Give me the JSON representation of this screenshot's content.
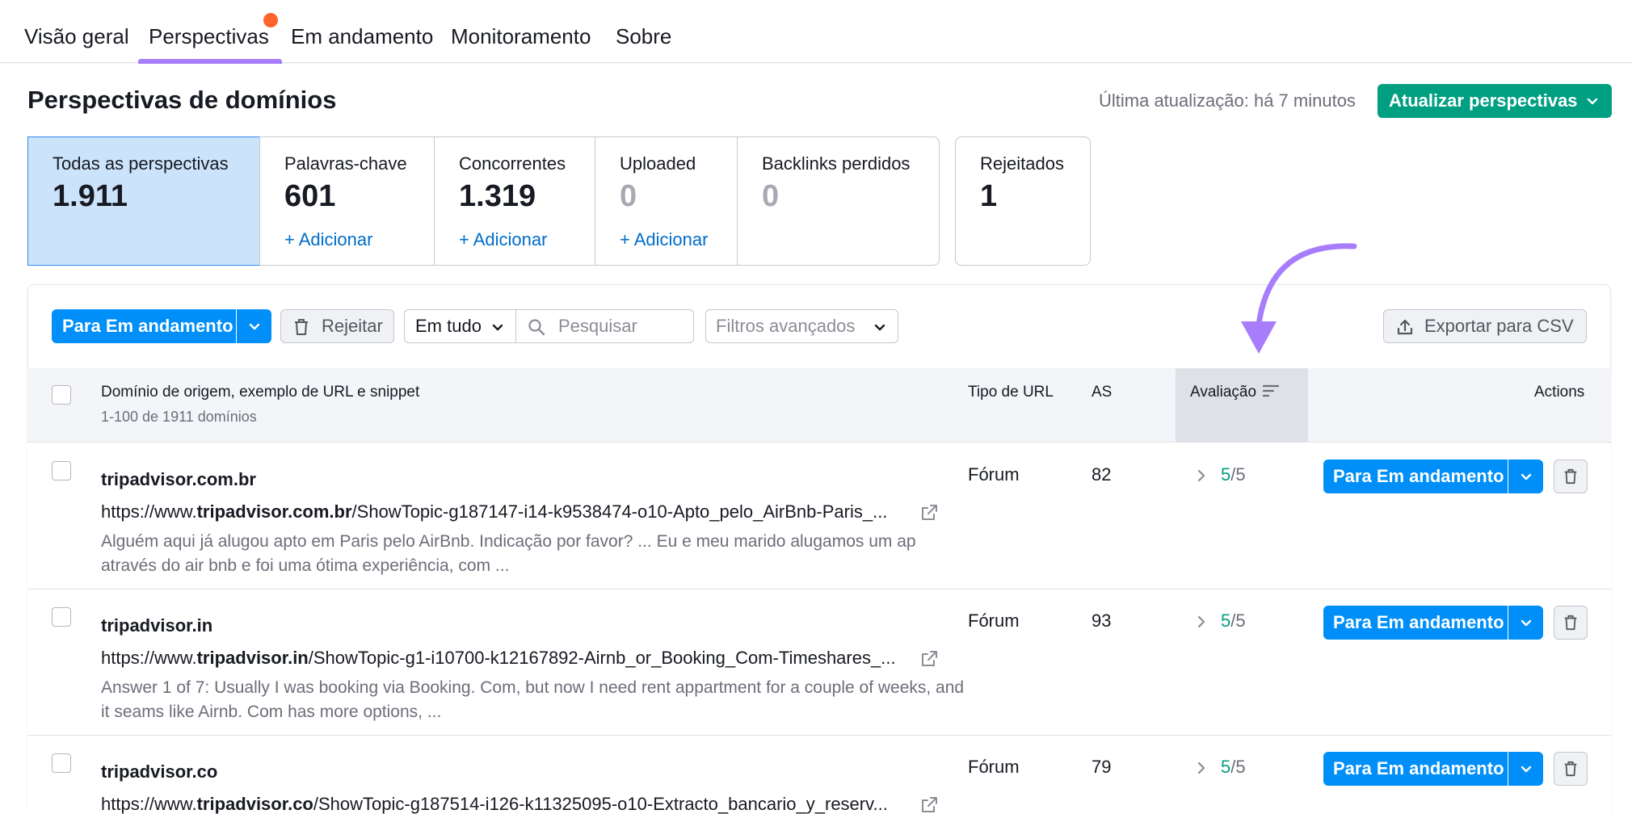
{
  "nav": {
    "tabs": [
      {
        "label": "Visão geral"
      },
      {
        "label": "Perspectivas"
      },
      {
        "label": "Em andamento"
      },
      {
        "label": "Monitoramento"
      },
      {
        "label": "Sobre"
      }
    ],
    "active_tab": "Perspectivas",
    "notification_color": "#ff642d"
  },
  "header": {
    "title": "Perspectivas de domínios",
    "last_update": "Última atualização: há 7 minutos",
    "update_button": "Atualizar perspectivas"
  },
  "cards": [
    {
      "label": "Todas as perspectivas",
      "value": "1.911",
      "add": ""
    },
    {
      "label": "Palavras-chave",
      "value": "601",
      "add": "+ Adicionar"
    },
    {
      "label": "Concorrentes",
      "value": "1.319",
      "add": "+ Adicionar"
    },
    {
      "label": "Uploaded",
      "value": "0",
      "add": "+ Adicionar"
    },
    {
      "label": "Backlinks perdidos",
      "value": "0",
      "add": ""
    },
    {
      "label": "Rejeitados",
      "value": "1",
      "add": ""
    }
  ],
  "toolbar": {
    "move_button": "Para Em andamento",
    "reject_button": "Rejeitar",
    "scope_select": "Em tudo",
    "search_placeholder": "Pesquisar",
    "filters": "Filtros avançados",
    "export_button": "Exportar para CSV"
  },
  "table": {
    "columns": {
      "domain": "Domínio de origem, exemplo de URL e snippet",
      "domain_sub": "1-100 de 1911 domínios",
      "type": "Tipo de URL",
      "as": "AS",
      "rating": "Avaliação",
      "actions": "Actions"
    },
    "rows": [
      {
        "domain": "tripadvisor.com.br",
        "url_prefix": "https://www.",
        "url_domain": "tripadvisor.com.br",
        "url_path": "/ShowTopic-g187147-i14-k9538474-o10-Apto_pelo_AirBnb-Paris_...",
        "snippet": "Alguém aqui já alugou apto em Paris pelo AirBnb. Indicação por favor? ... Eu e meu marido alugamos um ap através do air bnb e foi uma ótima experiência, com ...",
        "type": "Fórum",
        "as": "82",
        "score": "5",
        "score_max": "/5",
        "action": "Para Em andamento"
      },
      {
        "domain": "tripadvisor.in",
        "url_prefix": "https://www.",
        "url_domain": "tripadvisor.in",
        "url_path": "/ShowTopic-g1-i10700-k12167892-Airnb_or_Booking_Com-Timeshares_...",
        "snippet": "Answer 1 of 7: Usually I was booking via Booking. Com, but now I need rent appartment for a couple of weeks, and it seams like Airnb. Com has more options, ...",
        "type": "Fórum",
        "as": "93",
        "score": "5",
        "score_max": "/5",
        "action": "Para Em andamento"
      },
      {
        "domain": "tripadvisor.co",
        "url_prefix": "https://www.",
        "url_domain": "tripadvisor.co",
        "url_path": "/ShowTopic-g187514-i126-k11325095-o10-Extracto_bancario_y_reserv...",
        "snippet": "",
        "type": "Fórum",
        "as": "79",
        "score": "5",
        "score_max": "/5",
        "action": "Para Em andamento"
      }
    ]
  },
  "colors": {
    "accent_purple": "#a77dfb",
    "primary_blue": "#008ff8",
    "green": "#009f81",
    "link_blue": "#006dca"
  }
}
